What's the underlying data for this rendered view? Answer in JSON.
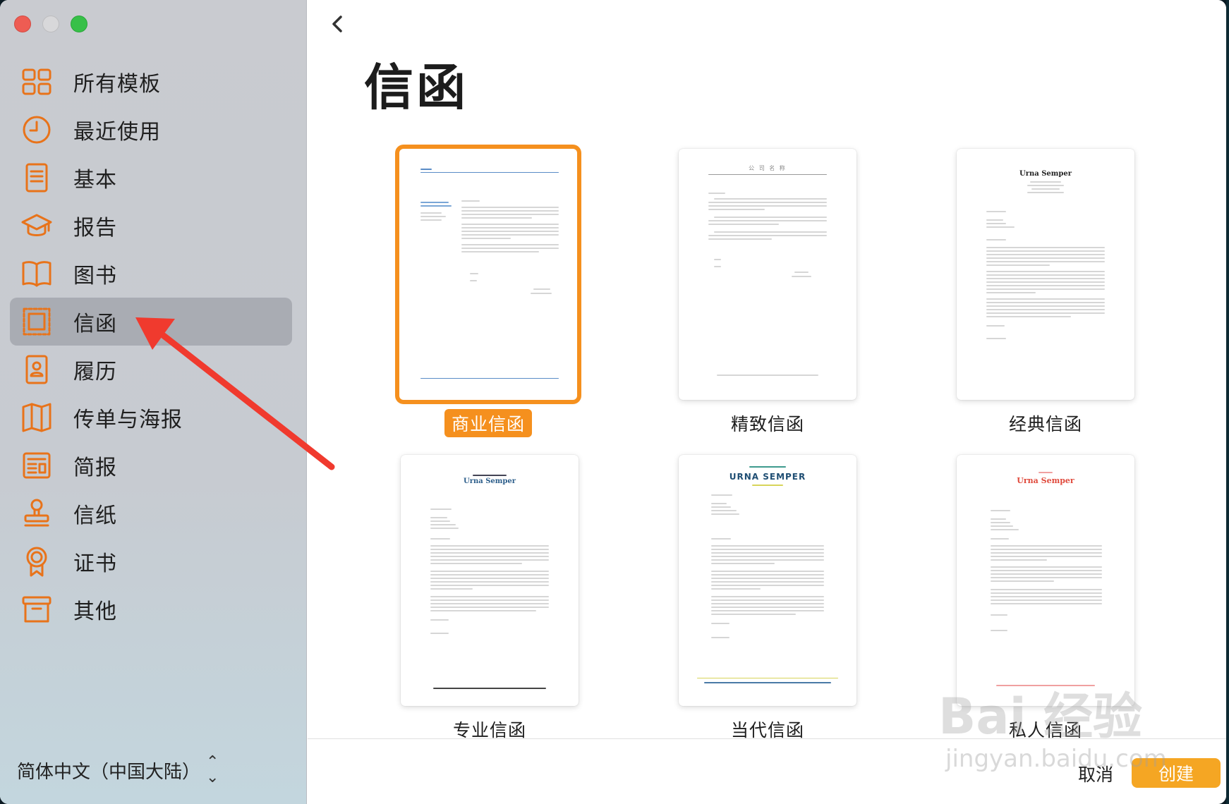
{
  "window": {
    "traffic_lights": [
      "close",
      "minimize",
      "zoom"
    ]
  },
  "sidebar": {
    "items": [
      {
        "label": "所有模板",
        "icon": "grid-icon",
        "active": false
      },
      {
        "label": "最近使用",
        "icon": "clock-icon",
        "active": false
      },
      {
        "label": "基本",
        "icon": "document-icon",
        "active": false
      },
      {
        "label": "报告",
        "icon": "graduation-cap-icon",
        "active": false
      },
      {
        "label": "图书",
        "icon": "book-icon",
        "active": false
      },
      {
        "label": "信函",
        "icon": "stamp-icon",
        "active": true
      },
      {
        "label": "履历",
        "icon": "id-badge-icon",
        "active": false
      },
      {
        "label": "传单与海报",
        "icon": "map-fold-icon",
        "active": false
      },
      {
        "label": "简报",
        "icon": "newsletter-icon",
        "active": false
      },
      {
        "label": "信纸",
        "icon": "rubber-stamp-icon",
        "active": false
      },
      {
        "label": "证书",
        "icon": "ribbon-award-icon",
        "active": false
      },
      {
        "label": "其他",
        "icon": "archive-box-icon",
        "active": false
      }
    ],
    "language": "简体中文（中国大陆）"
  },
  "main": {
    "title": "信函",
    "templates": [
      {
        "label": "商业信函",
        "selected": true
      },
      {
        "label": "精致信函",
        "selected": false
      },
      {
        "label": "经典信函",
        "selected": false
      },
      {
        "label": "专业信函",
        "selected": false
      },
      {
        "label": "当代信函",
        "selected": false
      },
      {
        "label": "私人信函",
        "selected": false
      }
    ],
    "thumb_text": {
      "elegant_header": "公 司 名 称",
      "classic_name": "Urna Semper",
      "professional_name": "Urna Semper",
      "contemporary_name": "URNA SEMPER",
      "personal_name": "Urna Semper"
    },
    "cancel_label": "取消",
    "create_label": "创建"
  },
  "watermark": {
    "text": "Bai 经验",
    "url_text": "jingyan.baidu.com"
  },
  "colors": {
    "accent": "#f5901e",
    "icon": "#e8731a",
    "create": "#f5a623",
    "arrow": "#f03a2e"
  }
}
